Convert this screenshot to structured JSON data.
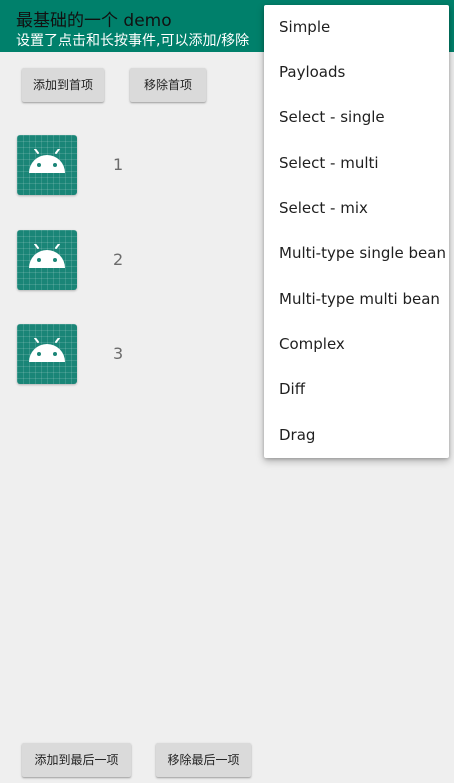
{
  "toolbar": {
    "title": "最基础的一个 demo",
    "subtitle": "设置了点击和长按事件,可以添加/移除"
  },
  "top_buttons": {
    "add_first": "添加到首项",
    "remove_first": "移除首项"
  },
  "list": {
    "items": [
      {
        "icon": "android-icon",
        "label": "1"
      },
      {
        "icon": "android-icon",
        "label": "2"
      },
      {
        "icon": "android-icon",
        "label": "3"
      }
    ]
  },
  "bottom_buttons": {
    "add_last": "添加到最后一项",
    "remove_last": "移除最后一项"
  },
  "menu": {
    "items": [
      "Simple",
      "Payloads",
      "Select - single",
      "Select - multi",
      "Select - mix",
      "Multi-type single bean",
      "Multi-type multi bean",
      "Complex",
      "Diff",
      "Drag"
    ]
  },
  "colors": {
    "toolbar": "#00806b",
    "background": "#efefef",
    "icon_bg": "#1a8577",
    "button": "#dadada"
  }
}
